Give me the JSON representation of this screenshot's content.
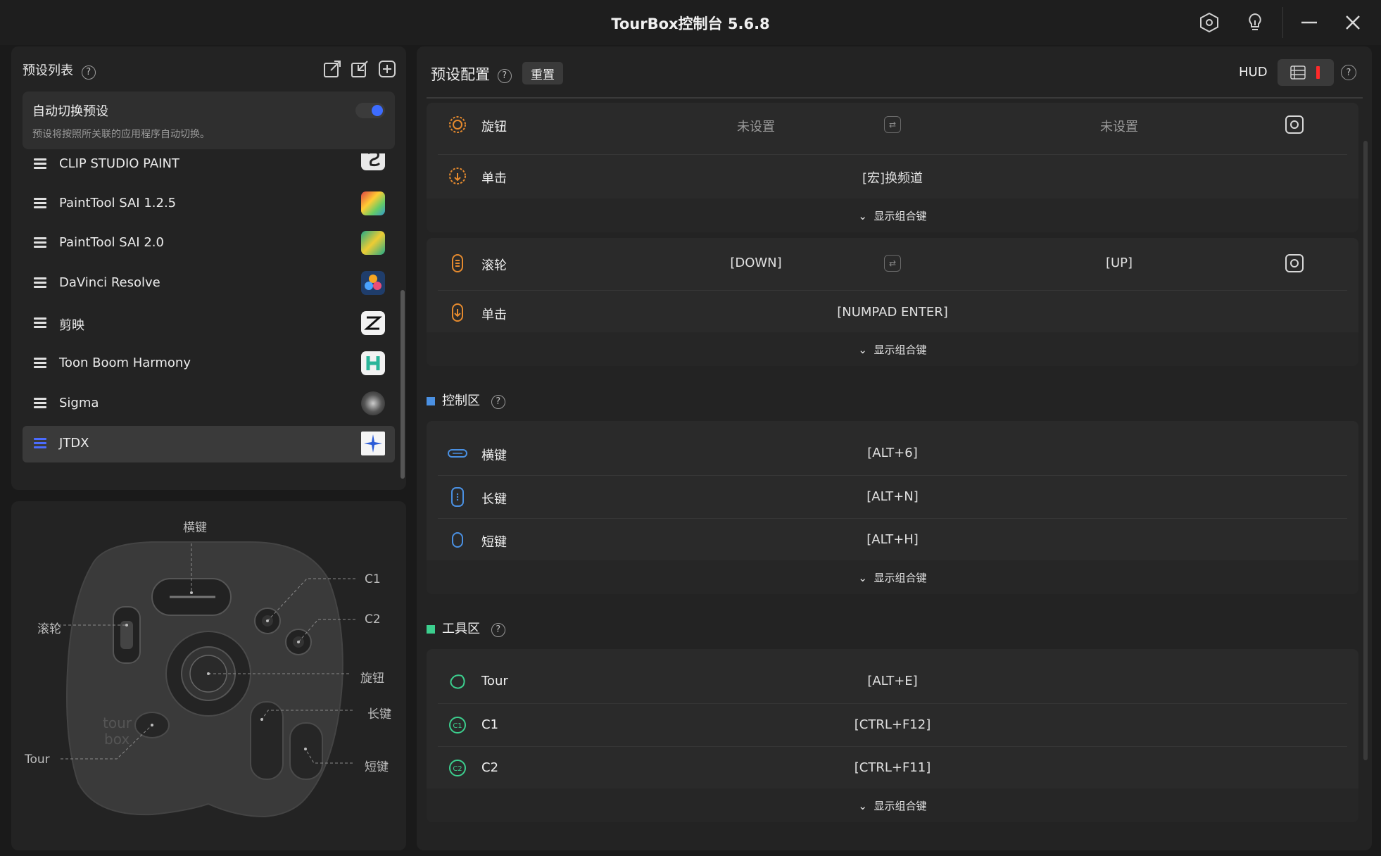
{
  "window": {
    "title": "TourBox控制台 5.6.8"
  },
  "sidebar": {
    "header": "预设列表",
    "auto_switch": {
      "title": "自动切换预设",
      "description": "预设将按照所关联的应用程序自动切换。",
      "enabled": true
    },
    "presets": [
      {
        "name": "CLIP STUDIO PAINT",
        "icon": "clip-studio-paint-icon",
        "active": false
      },
      {
        "name": "PaintTool SAI 1.2.5",
        "icon": "painttool-sai-1-icon",
        "active": false
      },
      {
        "name": "PaintTool SAI 2.0",
        "icon": "painttool-sai-2-icon",
        "active": false
      },
      {
        "name": "DaVinci Resolve",
        "icon": "davinci-resolve-icon",
        "active": false
      },
      {
        "name": "剪映",
        "icon": "jianying-icon",
        "active": false
      },
      {
        "name": "Toon Boom Harmony",
        "icon": "toon-boom-harmony-icon",
        "active": false
      },
      {
        "name": "Sigma",
        "icon": "sigma-icon",
        "active": false
      },
      {
        "name": "JTDX",
        "icon": "jtdx-icon",
        "active": true
      }
    ]
  },
  "device": {
    "labels": {
      "side": "横键",
      "c1": "C1",
      "c2": "C2",
      "scroll": "滚轮",
      "knob": "旋钮",
      "tall": "长键",
      "short": "短键",
      "tour": "Tour"
    }
  },
  "main": {
    "title": "预设配置",
    "reset_label": "重置",
    "hud_label": "HUD",
    "show_combo": "显示组合键",
    "knob_card": {
      "rotate_label": "旋钮",
      "rotate_left": "未设置",
      "rotate_right": "未设置",
      "click_label": "单击",
      "click_value": "[宏]换频道"
    },
    "scroll_card": {
      "rotate_label": "滚轮",
      "rotate_left": "[DOWN]",
      "rotate_right": "[UP]",
      "click_label": "单击",
      "click_value": "[NUMPAD ENTER]"
    },
    "control_section": {
      "title": "控制区",
      "rows": [
        {
          "label": "横键",
          "value": "[ALT+6]"
        },
        {
          "label": "长键",
          "value": "[ALT+N]"
        },
        {
          "label": "短键",
          "value": "[ALT+H]"
        }
      ]
    },
    "tool_section": {
      "title": "工具区",
      "rows": [
        {
          "label": "Tour",
          "value": "[ALT+E]"
        },
        {
          "label": "C1",
          "value": "[CTRL+F12]"
        },
        {
          "label": "C2",
          "value": "[CTRL+F11]"
        }
      ]
    }
  },
  "colors": {
    "accent_orange": "#e58a2e",
    "accent_green": "#3ccf8e",
    "control_blue": "#4a90e2",
    "toggle_blue": "#3d6cff"
  }
}
